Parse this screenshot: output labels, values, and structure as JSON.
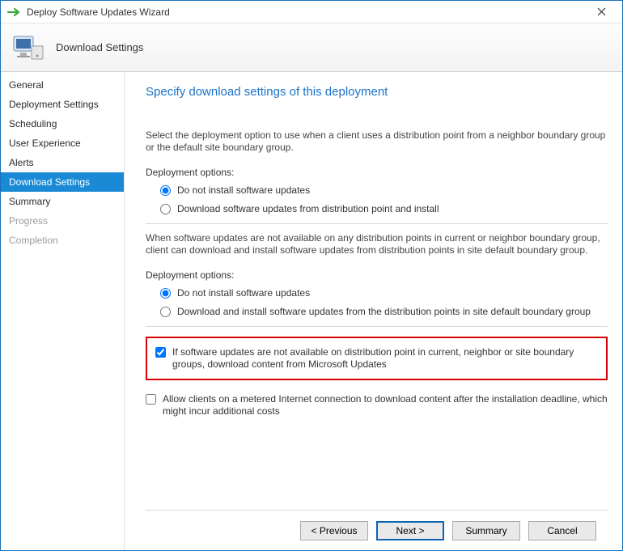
{
  "window": {
    "title": "Deploy Software Updates Wizard"
  },
  "header": {
    "page_title": "Download Settings"
  },
  "sidebar": {
    "items": [
      {
        "label": "General"
      },
      {
        "label": "Deployment Settings"
      },
      {
        "label": "Scheduling"
      },
      {
        "label": "User Experience"
      },
      {
        "label": "Alerts"
      },
      {
        "label": "Download Settings"
      },
      {
        "label": "Summary"
      },
      {
        "label": "Progress"
      },
      {
        "label": "Completion"
      }
    ]
  },
  "main": {
    "heading": "Specify download settings of this deployment",
    "section1": {
      "desc": "Select the deployment option to use when a client uses a distribution point from a neighbor boundary group or the default site boundary group.",
      "label": "Deployment options:",
      "opt1": "Do not install software updates",
      "opt2": "Download software updates from distribution point and install"
    },
    "section2": {
      "desc": "When software updates are not available on any distribution points in current or neighbor boundary group, client can download and install software updates from distribution points in site default boundary group.",
      "label": "Deployment options:",
      "opt1": "Do not install software updates",
      "opt2": "Download and install software updates from the distribution points in site default boundary group"
    },
    "check1": "If software updates are not available on distribution point in current, neighbor or site boundary groups, download content from Microsoft Updates",
    "check2": "Allow clients on a metered Internet connection to download content after the installation deadline, which might incur additional costs"
  },
  "footer": {
    "previous": "< Previous",
    "next": "Next >",
    "summary": "Summary",
    "cancel": "Cancel"
  }
}
